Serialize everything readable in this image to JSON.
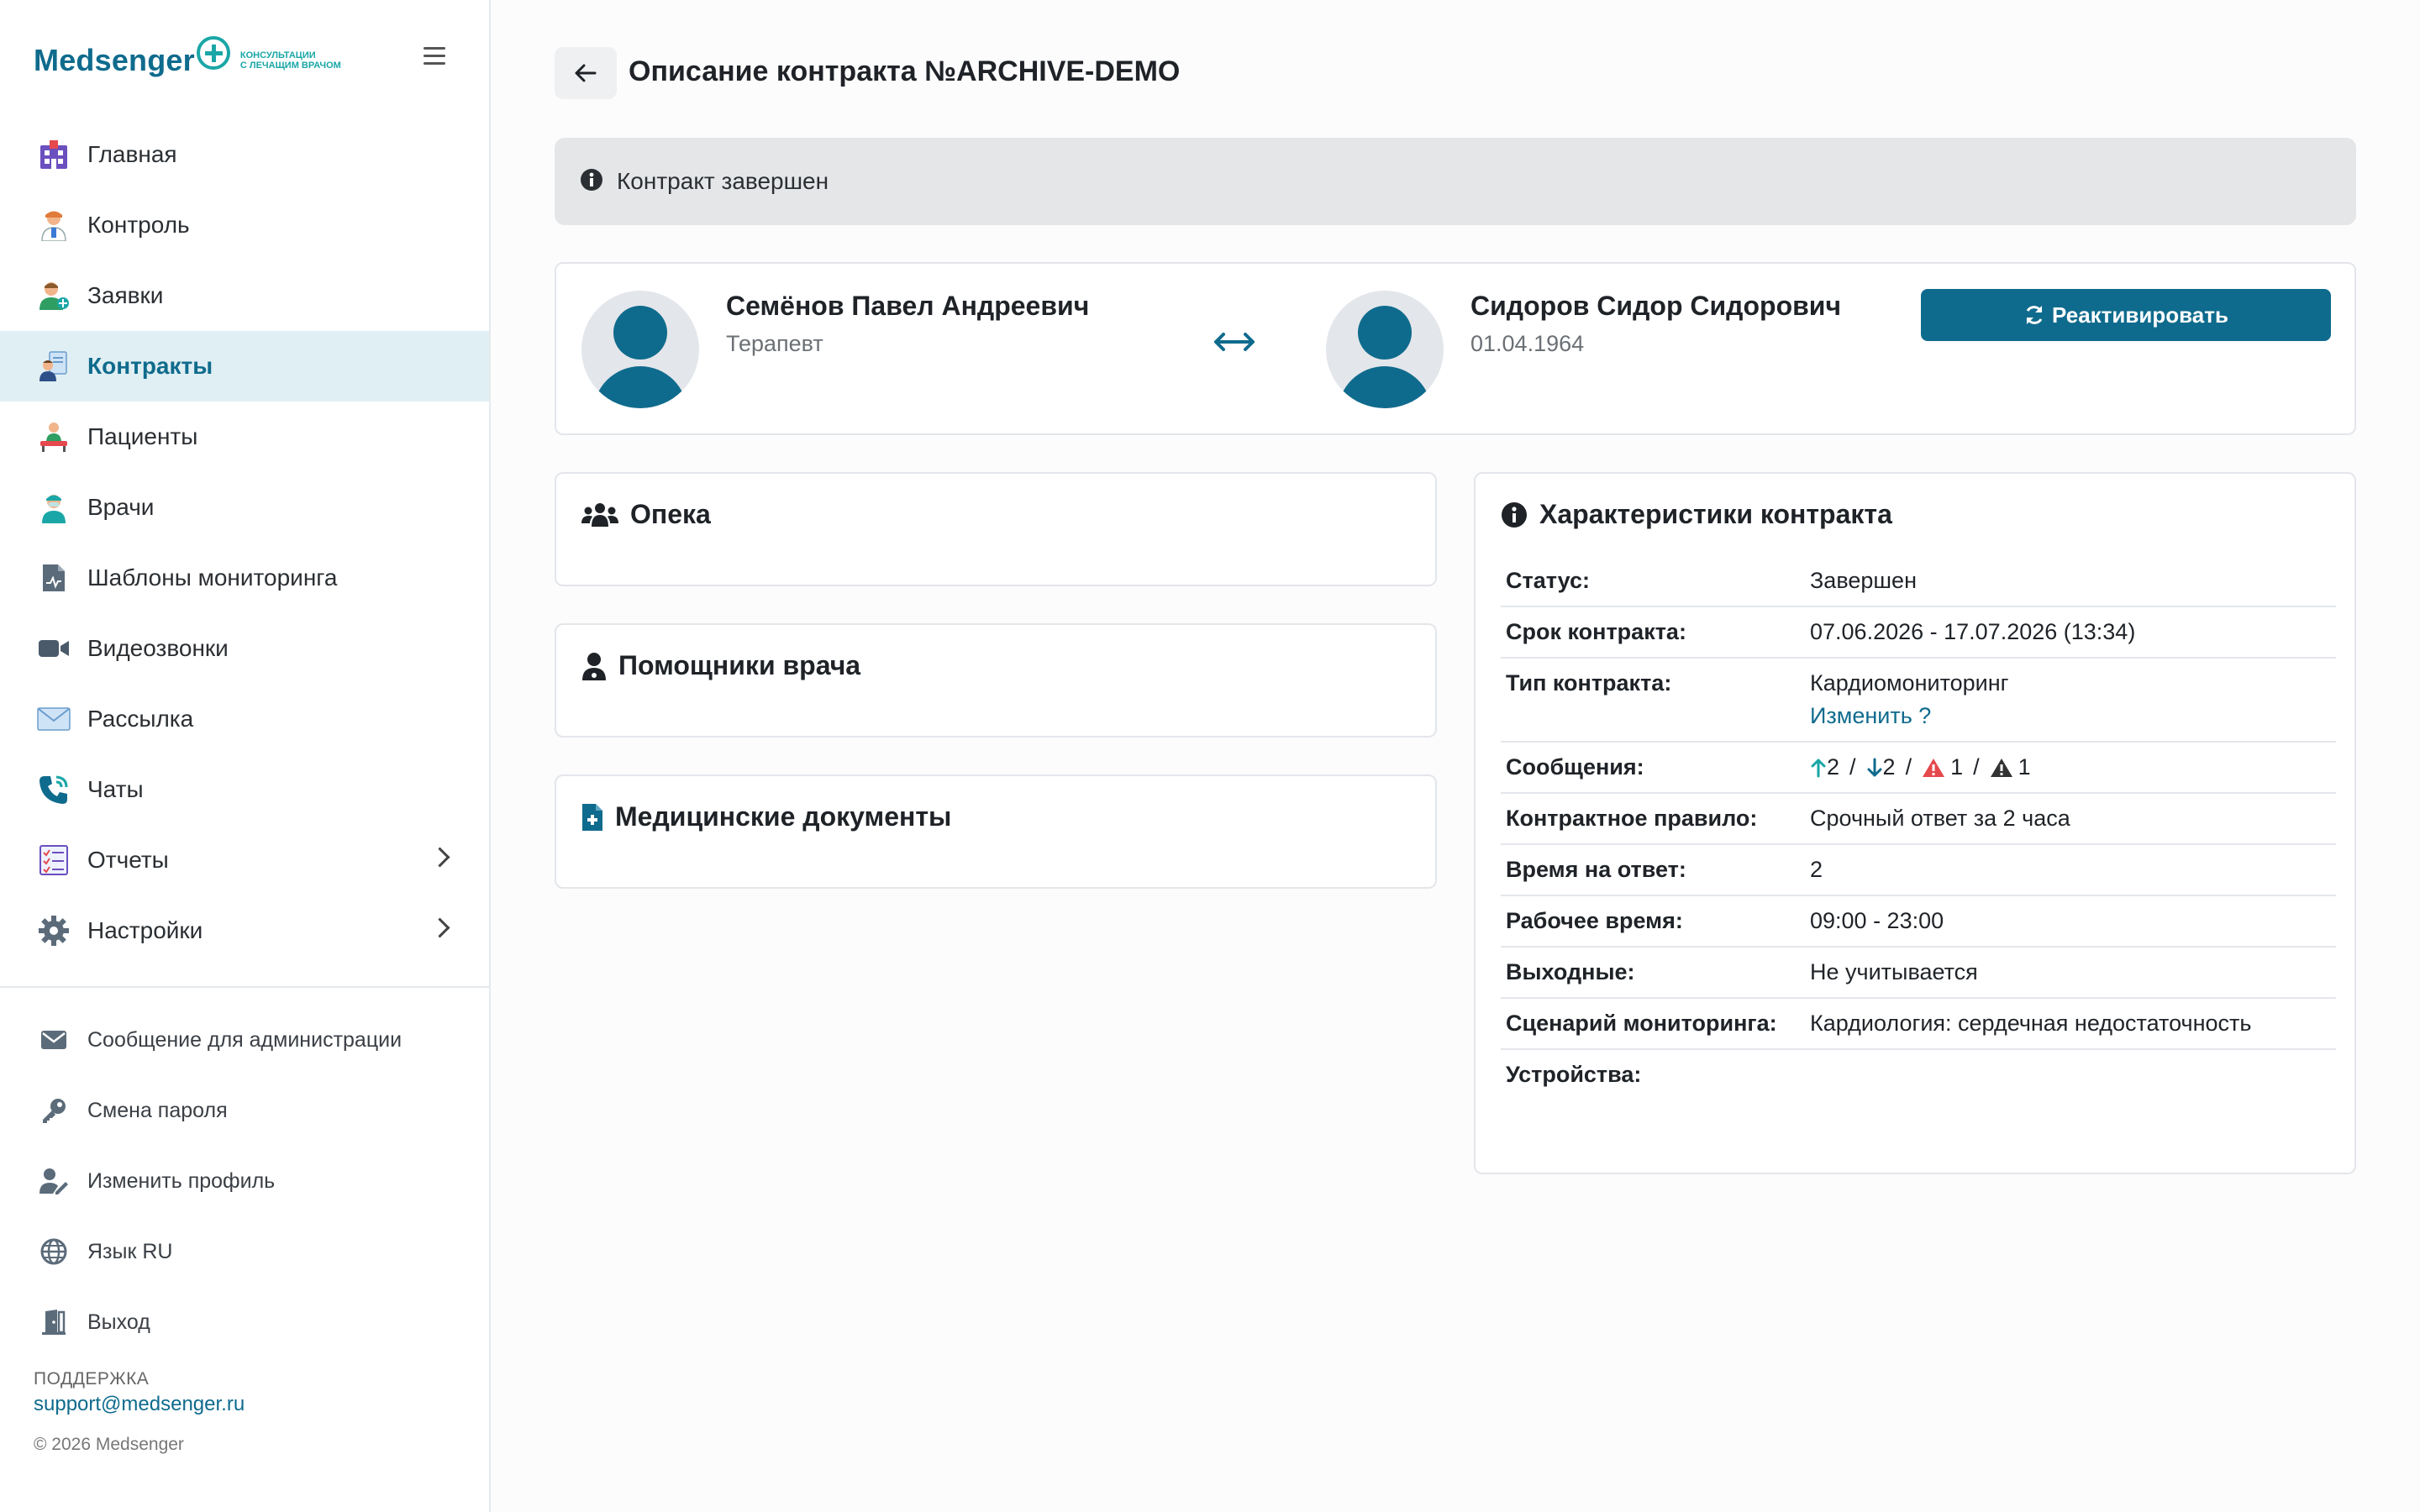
{
  "brand": {
    "name": "Medsenger",
    "tagline_line1": "КОНСУЛЬТАЦИИ",
    "tagline_line2": "С ЛЕЧАЩИМ ВРАЧОМ"
  },
  "sidebar": {
    "items": [
      {
        "label": "Главная"
      },
      {
        "label": "Контроль"
      },
      {
        "label": "Заявки"
      },
      {
        "label": "Контракты"
      },
      {
        "label": "Пациенты"
      },
      {
        "label": "Врачи"
      },
      {
        "label": "Шаблоны мониторинга"
      },
      {
        "label": "Видеозвонки"
      },
      {
        "label": "Рассылка"
      },
      {
        "label": "Чаты"
      },
      {
        "label": "Отчеты"
      },
      {
        "label": "Настройки"
      }
    ],
    "active_index": 3,
    "bottom_items": [
      {
        "label": "Сообщение для администрации"
      },
      {
        "label": "Смена пароля"
      },
      {
        "label": "Изменить профиль"
      },
      {
        "label": "Язык RU"
      },
      {
        "label": "Выход"
      }
    ],
    "support_label": "ПОДДЕРЖКА",
    "support_email": "support@medsenger.ru",
    "copyright": "© 2026 Medsenger"
  },
  "page": {
    "title": "Описание контракта №ARCHIVE-DEMO"
  },
  "alert": {
    "text": "Контракт завершен"
  },
  "parties": {
    "doctor": {
      "name": "Семёнов Павел Андреевич",
      "role": "Терапевт"
    },
    "patient": {
      "name": "Сидоров Сидор Сидорович",
      "birthdate": "01.04.1964"
    },
    "reactivate_label": "Реактивировать"
  },
  "sections": {
    "guardianship": "Опека",
    "assistants": "Помощники врача",
    "documents": "Медицинские документы"
  },
  "properties": {
    "title": "Характеристики контракта",
    "status": {
      "key": "Статус:",
      "value": "Завершен"
    },
    "term": {
      "key": "Срок контракта:",
      "value": "07.06.2026 - 17.07.2026 (13:34)"
    },
    "type": {
      "key": "Тип контракта:",
      "value": "Кардиомониторинг",
      "change": "Изменить ?"
    },
    "messages": {
      "key": "Сообщения:",
      "incoming": "2",
      "outgoing": "2",
      "warnings": "1",
      "alerts": "1",
      "separator": "/"
    },
    "rule": {
      "key": "Контрактное правило:",
      "value": "Срочный ответ за 2 часа"
    },
    "response_time": {
      "key": "Время на ответ:",
      "value": "2"
    },
    "work_hours": {
      "key": "Рабочее время:",
      "value": "09:00 - 23:00"
    },
    "weekends": {
      "key": "Выходные:",
      "value": "Не учитывается"
    },
    "scenario": {
      "key": "Сценарий мониторинга:",
      "value": "Кардиология: сердечная недостаточность"
    },
    "devices": {
      "key": "Устройства:",
      "value": ""
    }
  },
  "colors": {
    "accent": "#0f6b8d",
    "teal": "#1aa6a6",
    "warning": "#e5484d",
    "dark": "#333333"
  }
}
